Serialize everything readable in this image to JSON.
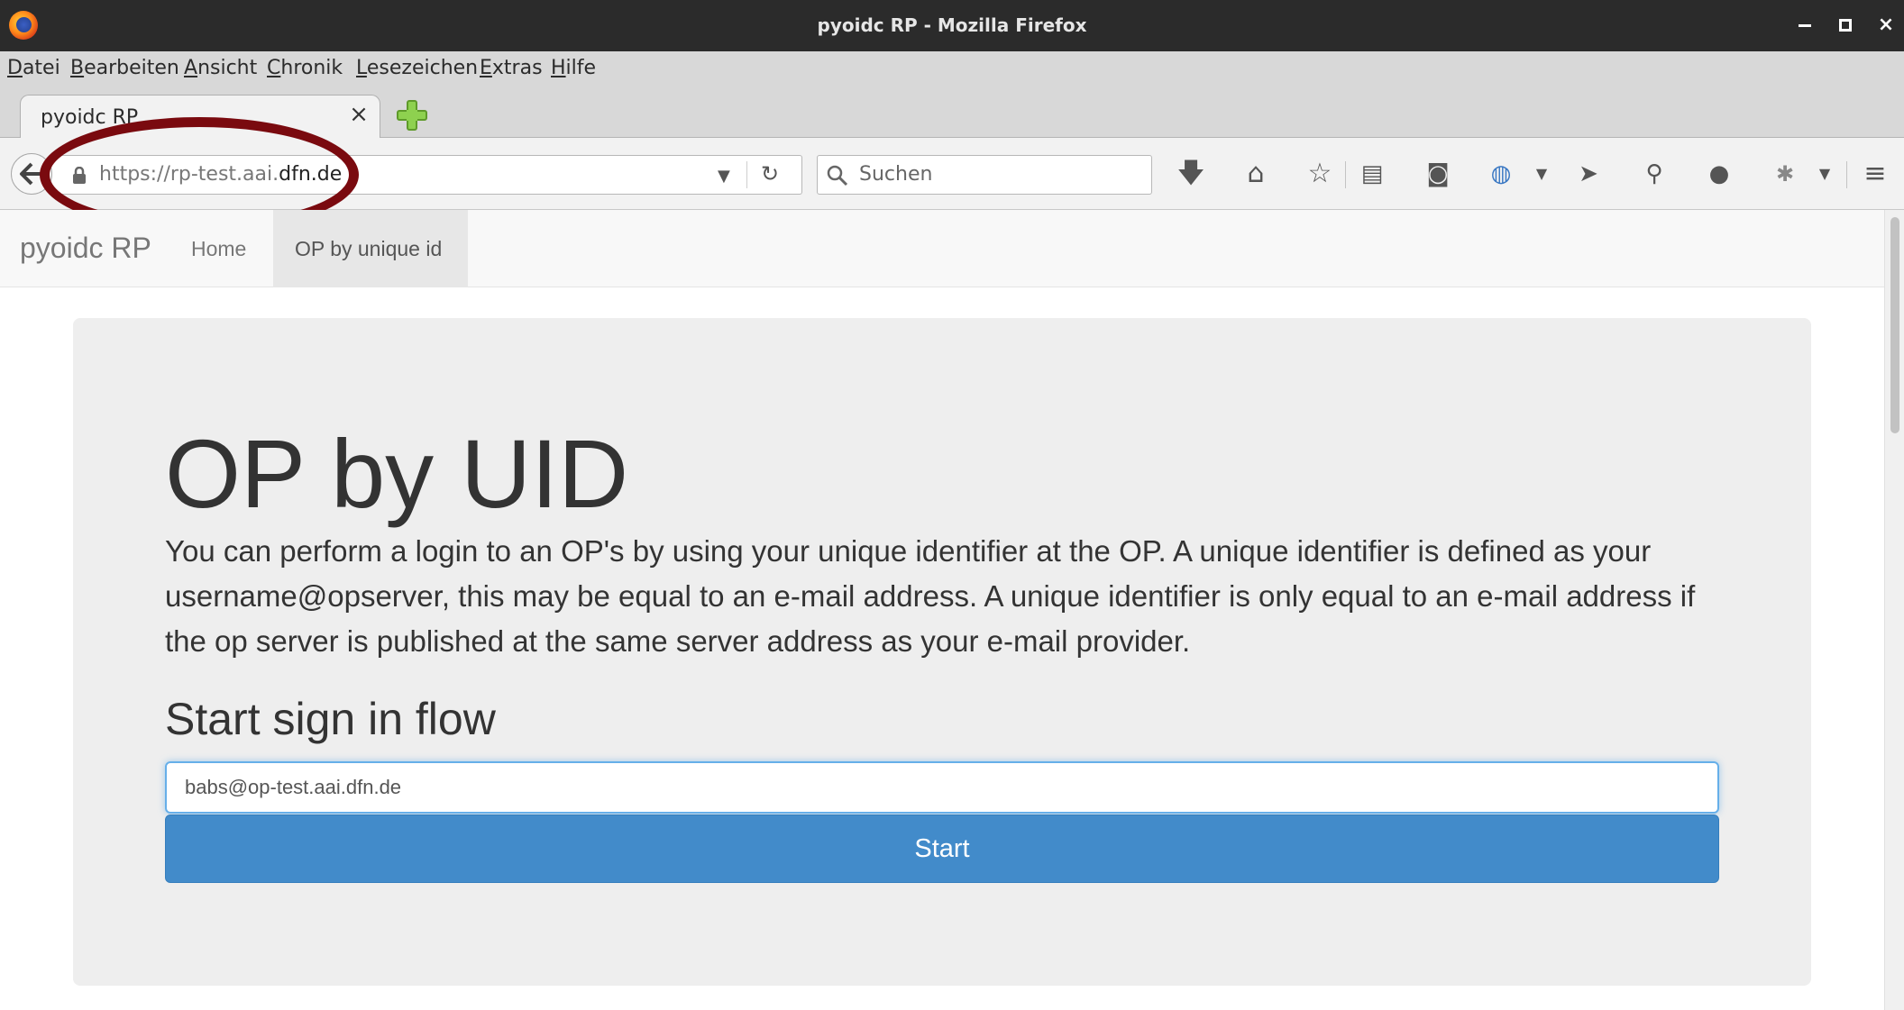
{
  "window": {
    "title": "pyoidc RP - Mozilla Firefox",
    "controls": {
      "minimize": "minimize-icon",
      "maximize": "maximize-icon",
      "close": "×"
    }
  },
  "menubar": {
    "items": [
      "Datei",
      "Bearbeiten",
      "Ansicht",
      "Chronik",
      "Lesezeichen",
      "Extras",
      "Hilfe"
    ]
  },
  "tabs": [
    {
      "label": "pyoidc RP",
      "close": "×",
      "active": true
    }
  ],
  "toolbar": {
    "url_prefix": "https://rp-test.aai.",
    "url_domain": "dfn.de",
    "search_placeholder": "Suchen",
    "icons": [
      "back-icon",
      "lock-icon",
      "url-dropdown-icon",
      "reload-icon",
      "search-icon",
      "download-icon",
      "home-icon",
      "bookmark-star-icon",
      "reader-list-icon",
      "pocket-icon",
      "globe-addon-icon",
      "send-icon",
      "pin-icon",
      "chat-icon",
      "extension-icon",
      "hamburger-menu-icon"
    ]
  },
  "site": {
    "brand": "pyoidc RP",
    "nav": {
      "home": "Home",
      "active": "OP by unique id"
    },
    "heading": "OP by UID",
    "description": "You can perform a login to an OP's by using your unique identifier at the OP. A unique identifier is defined as your username@opserver, this may be equal to an e-mail address. A unique identifier is only equal to an e-mail address if the op server is published at the same server address as your e-mail provider.",
    "form_title": "Start sign in flow",
    "input_value": "babs@op-test.aai.dfn.de",
    "button_label": "Start"
  },
  "colors": {
    "titlebar": "#2b2b2b",
    "highlight_ellipse": "#7a0a0f",
    "primary_button": "#428bca",
    "jumbotron": "#eeeeee"
  }
}
